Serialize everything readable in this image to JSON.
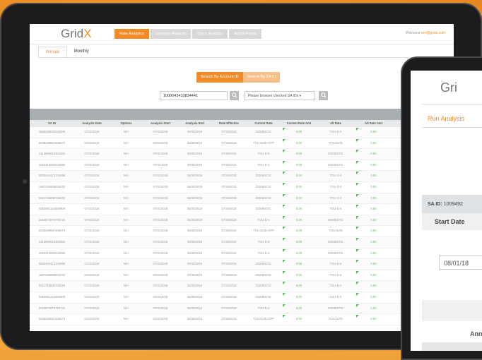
{
  "app": {
    "logo_prefix": "Grid",
    "logo_suffix": "X",
    "nav": [
      "Rate Analytics",
      "Scenario Analysis",
      "Batch Analysis",
      "Admin Portal"
    ],
    "welcome_prefix": "Welcome ",
    "welcome_user": "enr@gridx.com"
  },
  "tabs": [
    "Annual",
    "Monthly"
  ],
  "search": {
    "by_account_label": "Search By Account ID",
    "by_sa_label": "Search By SA ID",
    "account_value": "1000043410834441",
    "sa_select_text": "Please browser checked SA IDs ▾"
  },
  "table": {
    "columns": [
      "SA ID",
      "Analysis Date",
      "Options",
      "Analysis Start",
      "Analysis End",
      "Rate Effective",
      "Current Rate",
      "Current Rate Amt",
      "Alt Rate",
      "Alt Rate Amt"
    ],
    "rows": [
      [
        "3868386030042009",
        "07/31/2018",
        "N/A",
        "07/01/2018",
        "06/30/2019",
        "07/26/2019",
        "DOMESTIC",
        "0.00",
        "TOU-D-4",
        "0.00"
      ],
      [
        "9339259667405673",
        "07/31/2018",
        "N/A",
        "07/01/2018",
        "06/30/2019",
        "07/26/2019",
        "TOU-D2/E-CPP",
        "0.00",
        "TOU-D2/D",
        "0.00"
      ],
      [
        "3413894913921802",
        "07/31/2018",
        "N/A",
        "07/01/2018",
        "06/30/2019",
        "07/26/2019",
        "TOU-D-5",
        "0.00",
        "DOMESTIC",
        "0.00"
      ],
      [
        "4663316693023965",
        "07/31/2018",
        "N/A",
        "07/01/2018",
        "06/30/2019",
        "07/26/2019",
        "TOU-D-4",
        "0.00",
        "DOMESTIC",
        "0.00"
      ],
      [
        "0833424471744068",
        "07/31/2018",
        "N/A",
        "07/01/2018",
        "06/30/2019",
        "07/26/2019",
        "DOMESTIC",
        "0.00",
        "TOU-D-4",
        "0.00"
      ],
      [
        "1667026906804633",
        "07/31/2018",
        "N/A",
        "07/01/2018",
        "06/30/2019",
        "07/26/2019",
        "DOMESTIC",
        "0.00",
        "TOU-D-4",
        "0.00"
      ],
      [
        "5011718636736029",
        "07/31/2018",
        "N/A",
        "07/01/2018",
        "06/30/2019",
        "07/26/2019",
        "DOMESTIC",
        "0.00",
        "TOU-D-4",
        "0.00"
      ],
      [
        "9383951144392809",
        "07/31/2018",
        "N/A",
        "07/01/2018",
        "06/30/2019",
        "07/26/2019",
        "DOMESTIC",
        "0.00",
        "TOU-D-4",
        "0.00"
      ],
      [
        "2323974574760744",
        "07/31/2018",
        "N/A",
        "07/01/2018",
        "06/30/2019",
        "07/26/2019",
        "TOU-D-4",
        "0.00",
        "DOMESTIC",
        "0.00"
      ],
      [
        "9339259667405673",
        "07/31/2018",
        "N/A",
        "07/01/2018",
        "06/30/2019",
        "07/26/2019",
        "TOU-D2/E-CPP",
        "0.00",
        "TOU-D2/D",
        "0.00"
      ],
      [
        "3413894913921802",
        "07/31/2018",
        "N/A",
        "07/01/2018",
        "06/30/2019",
        "07/26/2019",
        "TOU-D-5",
        "0.00",
        "DOMESTIC",
        "0.00"
      ],
      [
        "4663316693023965",
        "07/31/2018",
        "N/A",
        "07/01/2018",
        "06/30/2019",
        "07/26/2019",
        "TOU-D-4",
        "0.00",
        "DOMESTIC",
        "0.00"
      ],
      [
        "0833424471744068",
        "07/31/2018",
        "N/A",
        "07/01/2018",
        "06/30/2019",
        "07/26/2019",
        "DOMESTIC",
        "0.00",
        "TOU-D-4",
        "0.00"
      ],
      [
        "1667026906804633",
        "07/31/2018",
        "N/A",
        "07/01/2018",
        "06/30/2019",
        "07/26/2019",
        "DOMESTIC",
        "0.00",
        "TOU-D-4",
        "0.00"
      ],
      [
        "5011718636736029",
        "07/31/2018",
        "N/A",
        "07/01/2018",
        "06/30/2019",
        "07/26/2019",
        "DOMESTIC",
        "0.00",
        "TOU-D-4",
        "0.00"
      ],
      [
        "9383951144392809",
        "07/31/2018",
        "N/A",
        "07/01/2018",
        "06/30/2019",
        "07/26/2019",
        "DOMESTIC",
        "0.00",
        "TOU-D-4",
        "0.00"
      ],
      [
        "2323974574760744",
        "07/31/2018",
        "N/A",
        "07/01/2018",
        "06/30/2019",
        "07/26/2019",
        "TOU-D-4",
        "0.00",
        "DOMESTIC",
        "0.00"
      ],
      [
        "9339259667405673",
        "07/31/2018",
        "N/A",
        "07/01/2018",
        "06/30/2019",
        "07/26/2019",
        "TOU-D2/E-CPP",
        "0.00",
        "TOU-D2/D",
        "0.00"
      ]
    ]
  },
  "second_tablet": {
    "logo": "Gri",
    "run_analysis": "Run Analysis",
    "sa_id_label": "SA ID:",
    "sa_id_value": "1009492",
    "start_date_label": "Start Date",
    "start_date_value": "08/01/18",
    "annual_label": "Ann"
  },
  "colors": {
    "accent": "#f28c28",
    "bezel": "#1c1c1e",
    "background": "#f0a23a",
    "positive": "#5cb85c"
  }
}
